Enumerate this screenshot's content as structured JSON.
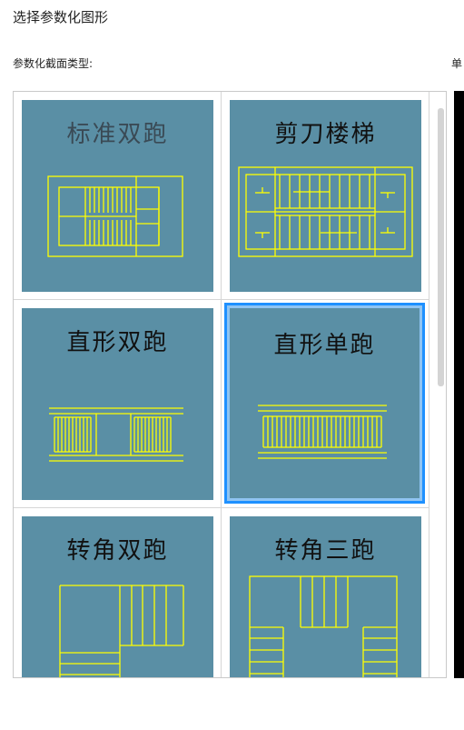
{
  "dialog": {
    "title": "选择参数化图形",
    "section_label": "参数化截面类型:",
    "right_label_partial": "单"
  },
  "gallery": {
    "items": [
      {
        "label": "标准双跑",
        "icon": "standard-double-run-stair-icon",
        "selected": false
      },
      {
        "label": "剪刀楼梯",
        "icon": "scissor-stair-icon",
        "selected": false
      },
      {
        "label": "直形双跑",
        "icon": "straight-double-run-stair-icon",
        "selected": false
      },
      {
        "label": "直形单跑",
        "icon": "straight-single-run-stair-icon",
        "selected": true
      },
      {
        "label": "转角双跑",
        "icon": "corner-double-run-stair-icon",
        "selected": false
      },
      {
        "label": "转角三跑",
        "icon": "corner-triple-run-stair-icon",
        "selected": false
      }
    ]
  },
  "colors": {
    "thumb_bg": "#5a8fa5",
    "stair_line": "#ffff00",
    "selection": "#1e90ff"
  }
}
